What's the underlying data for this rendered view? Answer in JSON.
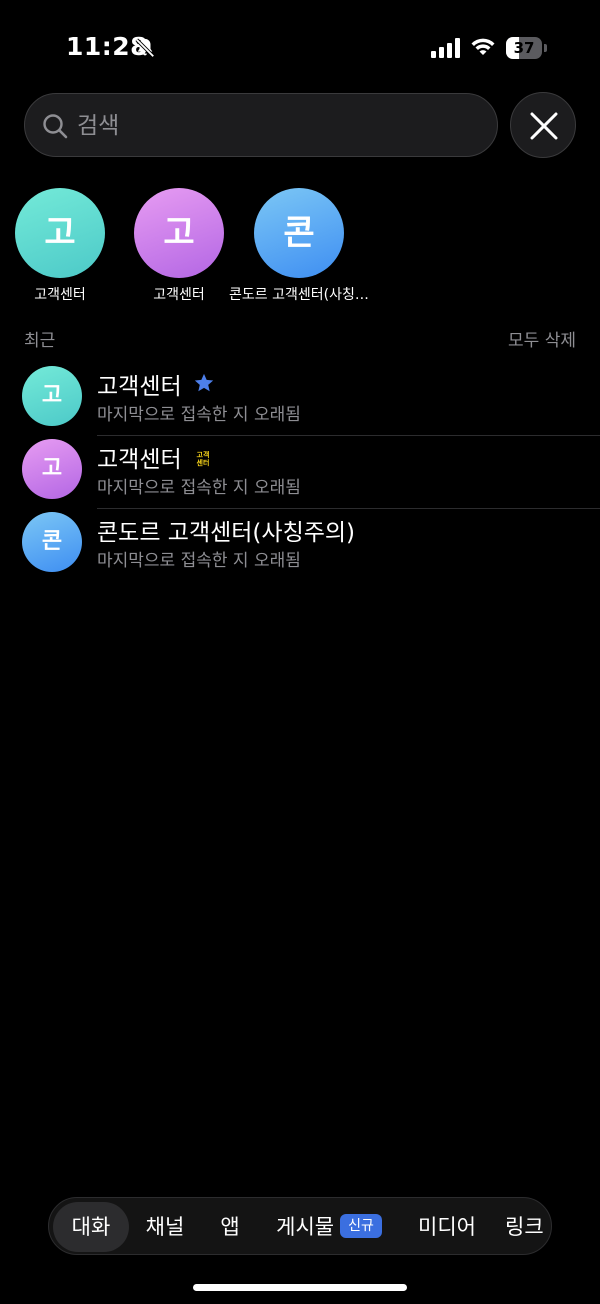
{
  "status_bar": {
    "time": "11:28",
    "battery": 37,
    "icons": [
      "bell-off-icon",
      "signal-icon",
      "wifi-icon",
      "battery-icon"
    ]
  },
  "search": {
    "placeholder": "검색",
    "value": ""
  },
  "recent_chips": [
    {
      "initial": "고",
      "label": "고객센터",
      "color": "teal"
    },
    {
      "initial": "고",
      "label": "고객센터",
      "color": "purple"
    },
    {
      "initial": "콘",
      "label": "콘도르 고객센터(사칭주의)",
      "color": "blue"
    }
  ],
  "recent_section": {
    "title": "최근",
    "clear_all": "모두 삭제"
  },
  "results": [
    {
      "initial": "고",
      "title": "고객센터",
      "subtitle": "마지막으로 접속한 지 오래됨",
      "badge": "star-icon",
      "color": "teal"
    },
    {
      "initial": "고",
      "title": "고객센터",
      "subtitle": "마지막으로 접속한 지 오래됨",
      "badge": "cs-badge-icon",
      "badge_text": "고객센터",
      "color": "purple"
    },
    {
      "initial": "콘",
      "title": "콘도르 고객센터(사칭주의)",
      "subtitle": "마지막으로 접속한 지 오래됨",
      "badge": null,
      "color": "blue"
    }
  ],
  "tabs": [
    {
      "label": "대화",
      "active": true
    },
    {
      "label": "채널",
      "active": false
    },
    {
      "label": "앱",
      "active": false
    },
    {
      "label": "게시물",
      "badge": "신규",
      "active": false
    },
    {
      "label": "미디어",
      "active": false
    },
    {
      "label": "링크",
      "active": false
    }
  ],
  "colors": {
    "background": "#000000",
    "teal": "#5fd9d0",
    "purple": "#cf83ea",
    "blue": "#5aa8f4",
    "accent_badge": "#3b6fe0",
    "muted_text": "#8e8e93"
  }
}
